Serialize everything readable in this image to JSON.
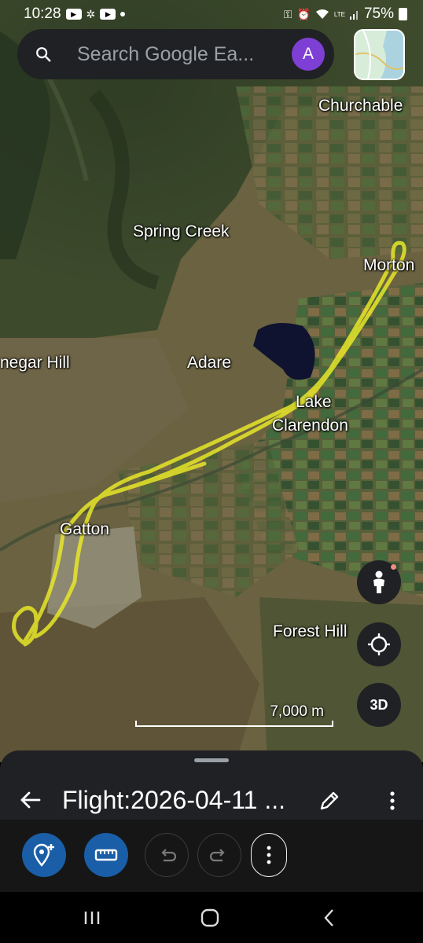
{
  "status_bar": {
    "time": "10:28",
    "battery": "75%",
    "network": "LTE",
    "left_icons": [
      "youtube-icon",
      "pinwheel-icon",
      "youtube-icon",
      "dot-icon"
    ],
    "right_icons": [
      "key-icon",
      "alarm-icon",
      "wifi-icon",
      "signal-icon",
      "battery-icon"
    ]
  },
  "search": {
    "placeholder": "Search Google Ea...",
    "avatar_letter": "A",
    "avatar_color": "#7e3fd4"
  },
  "map": {
    "places": [
      "Churchable",
      "Spring Creek",
      "Morton",
      "negar Hill",
      "Adare",
      "Lake",
      "Clarendon",
      "Gatton",
      "Forest Hill"
    ],
    "scale_label": "7,000 m",
    "track_color": "#e7e629"
  },
  "controls": {
    "view_3d_label": "3D",
    "pegman_icon": "pegman-icon",
    "location_icon": "my-location-icon"
  },
  "sheet": {
    "title": "Flight:2026-04-11 ...",
    "accent": "#1a5ea8"
  },
  "nav": {
    "icons": [
      "recents-icon",
      "home-icon",
      "back-icon"
    ]
  }
}
